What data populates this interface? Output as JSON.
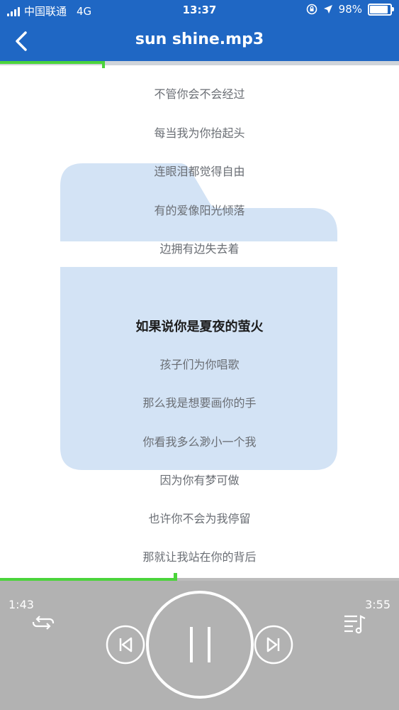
{
  "status_bar": {
    "carrier": "中国联通",
    "network": "4G",
    "time": "13:37",
    "battery": "98%",
    "battery_level": 0.98
  },
  "header": {
    "title": "sun shine.mp3",
    "back_icon": "chevron-left-icon"
  },
  "top_progress": {
    "fraction": 0.26
  },
  "lyrics": {
    "lines": [
      "不管你会不会经过",
      "每当我为你抬起头",
      "连眼泪都觉得自由",
      "有的爱像阳光倾落",
      "边拥有边失去着",
      "如果说你是夏夜的萤火",
      "孩子们为你唱歌",
      "那么我是想要画你的手",
      "你看我多么渺小一个我",
      "因为你有梦可做",
      "也许你不会为我停留",
      "那就让我站在你的背后"
    ],
    "active_index": 5
  },
  "player": {
    "elapsed": "1:43",
    "total": "3:55",
    "progress_fraction": 0.438,
    "icons": {
      "repeat": "repeat-icon",
      "previous": "previous-track-icon",
      "play_pause": "pause-icon",
      "next": "next-track-icon",
      "playlist": "playlist-icon"
    }
  },
  "colors": {
    "header": "#1f67c4",
    "progress": "#4bd43b",
    "player_panel": "#b2b2b2",
    "folder": "#d3e3f5"
  }
}
